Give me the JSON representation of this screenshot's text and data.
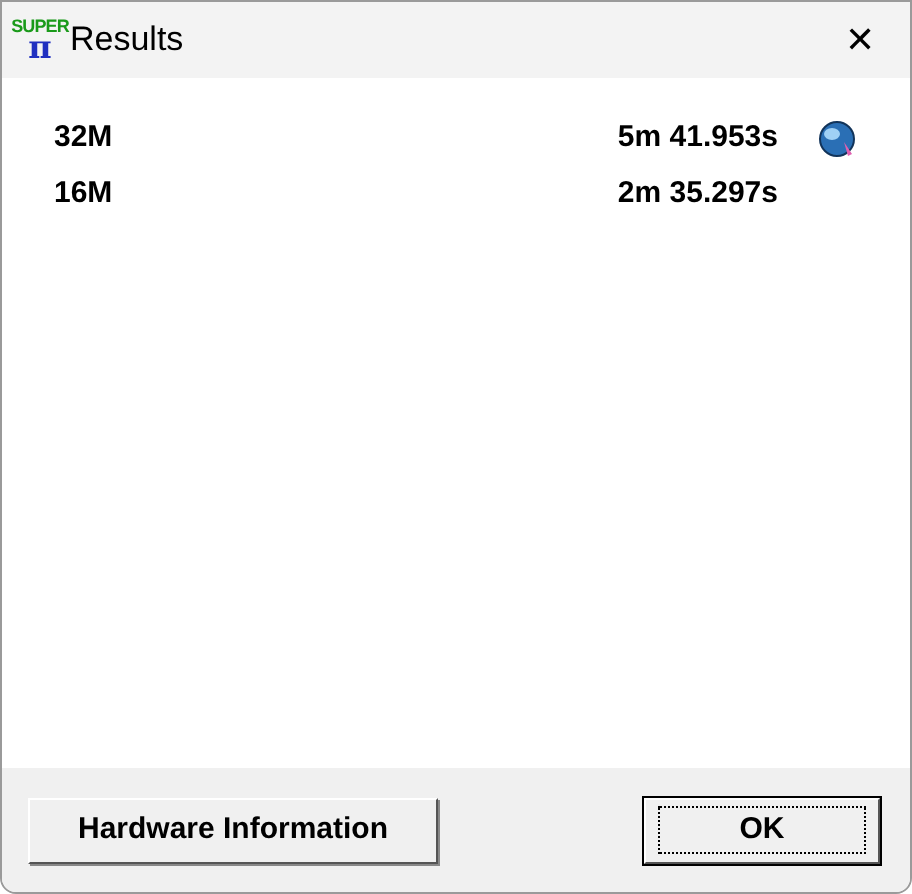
{
  "window": {
    "title": "Results",
    "logo": {
      "top": "SUPER",
      "bottom": "π"
    },
    "close": "✕"
  },
  "results": [
    {
      "size": "32M",
      "time": "5m 41.953s",
      "kind": "latest"
    },
    {
      "size": "16M",
      "time": "2m 35.297s",
      "kind": "plain"
    }
  ],
  "buttons": [
    {
      "label": "Hardware Information",
      "focused": false
    },
    {
      "label": "OK",
      "focused": true
    }
  ]
}
